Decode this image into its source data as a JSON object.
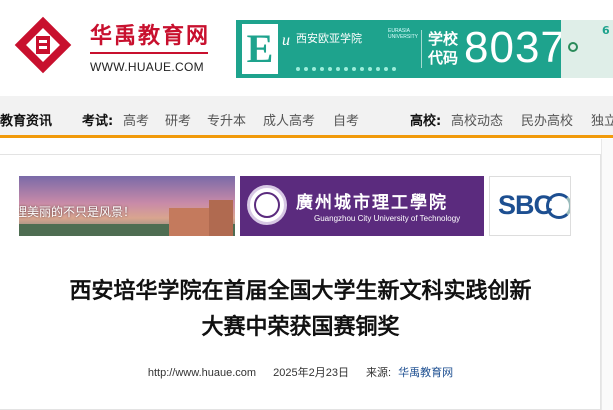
{
  "header": {
    "site_name": "华禹教育网",
    "site_url": "WWW.HUAUE.COM",
    "banner": {
      "letter": "E",
      "letter2": "u",
      "school_name": "西安欧亚学院",
      "school_name_en": "EURASIA UNIVERSITY",
      "code_label": "学校代码",
      "code": "8037",
      "right_text": "6"
    }
  },
  "nav": {
    "items": [
      {
        "label": "教育资讯"
      },
      {
        "label": "考试:"
      },
      {
        "label": "高考"
      },
      {
        "label": "研考"
      },
      {
        "label": "专升本"
      },
      {
        "label": "成人高考"
      },
      {
        "label": "自考"
      },
      {
        "label": "高校:"
      },
      {
        "label": "高校动态"
      },
      {
        "label": "民办高校"
      },
      {
        "label": "独立"
      }
    ]
  },
  "ads": {
    "ad1_text": "理美丽的不只是风景！",
    "ad2_cn": "廣州城市理工學院",
    "ad2_en": "Guangzhou City University of Technology",
    "ad3_text": "SBC"
  },
  "article": {
    "title_line1": "西安培华学院在首届全国大学生新文科实践创新",
    "title_line2": "大赛中荣获国赛铜奖",
    "url": "http://www.huaue.com",
    "date": "2025年2月23日",
    "source_label": "来源:",
    "source": "华禹教育网"
  },
  "colors": {
    "brand": "#c8102e",
    "nav_accent": "#f19a0b",
    "banner": "#1ea38d",
    "gcu_purple": "#5b2b7e"
  }
}
